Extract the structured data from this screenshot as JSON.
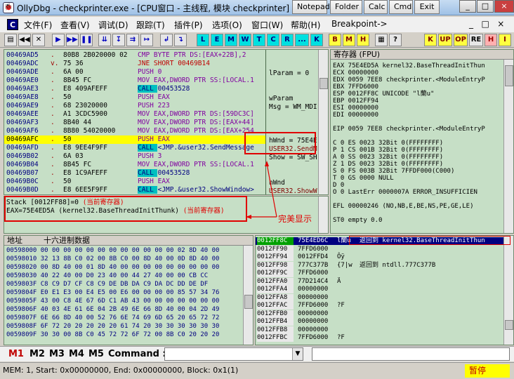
{
  "window": {
    "title": "OllyDbg - checkprinter.exe - [CPU窗口 - 主线程, 模块 checkprinter]",
    "taskbar_buttons": [
      "Notepad",
      "Folder",
      "Calc",
      "Cmd",
      "Exit"
    ],
    "controls": [
      "_",
      "□",
      "×"
    ]
  },
  "menu": {
    "logo": "C",
    "items": [
      "文件(F)",
      "查看(V)",
      "调试(D)",
      "跟踪(T)",
      "插件(P)",
      "选项(O)",
      "窗口(W)",
      "帮助(H)",
      "Breakpoint->"
    ],
    "right_controls": [
      "_",
      "□",
      "×"
    ]
  },
  "toolbar": {
    "control_glyphs": [
      "◀◀",
      "✕",
      "▶",
      "▶▶",
      "❚❚",
      "⇊",
      "↧",
      "⇉",
      "↦",
      "↲",
      "↴"
    ],
    "letters_cyan": [
      "L",
      "E",
      "M",
      "W",
      "T",
      "C",
      "R",
      "...",
      "K"
    ],
    "letters_yellow": [
      "B",
      "M",
      "H"
    ],
    "right_buttons": [
      "K",
      "UP",
      "OP",
      "RE",
      "H",
      "I"
    ]
  },
  "disasm": {
    "rows": [
      {
        "addr": "00469AD5",
        "mark": ".",
        "hex": "80B8 2B020000 02",
        "asm": "CMP BYTE PTR DS:[EAX+22B],2"
      },
      {
        "addr": "00469ADC",
        "mark": "v.",
        "hex": "75 36",
        "asm": "JNE SHORT 00469B14"
      },
      {
        "addr": "00469ADE",
        "mark": ".",
        "hex": "6A 00",
        "asm": "PUSH 0"
      },
      {
        "addr": "00469AE0",
        "mark": ".",
        "hex": "8B45 FC",
        "asm": "MOV EAX,DWORD PTR SS:[LOCAL.1"
      },
      {
        "addr": "00469AE3",
        "mark": ".",
        "hex": "E8 409AFEFF",
        "asm": "CALL 00453528"
      },
      {
        "addr": "00469AE8",
        "mark": ".",
        "hex": "50",
        "asm": "PUSH EAX"
      },
      {
        "addr": "00469AE9",
        "mark": ".",
        "hex": "68 23020000",
        "asm": "PUSH 223"
      },
      {
        "addr": "00469AEE",
        "mark": ".",
        "hex": "A1 3CDC5900",
        "asm": "MOV EAX,DWORD PTR DS:[59DC3C]"
      },
      {
        "addr": "00469AF3",
        "mark": ".",
        "hex": "8B40 44",
        "asm": "MOV EAX,DWORD PTR DS:[EAX+44]"
      },
      {
        "addr": "00469AF6",
        "mark": ".",
        "hex": "8B80 54020000",
        "asm": "MOV EAX,DWORD PTR DS:[EAX+254"
      },
      {
        "addr": "00469AFC",
        "mark": ".",
        "hex": "50",
        "asm": "PUSH EAX"
      },
      {
        "addr": "00469AFD",
        "mark": ".",
        "hex": "E8 9EE4F9FF",
        "asm": "CALL <JMP.&user32.SendMessage"
      },
      {
        "addr": "00469B02",
        "mark": ".",
        "hex": "6A 03",
        "asm": "PUSH 3"
      },
      {
        "addr": "00469B04",
        "mark": ".",
        "hex": "8B45 FC",
        "asm": "MOV EAX,DWORD PTR SS:[LOCAL.1"
      },
      {
        "addr": "00469B07",
        "mark": ".",
        "hex": "E8 1C9AFEFF",
        "asm": "CALL 00453528"
      },
      {
        "addr": "00469B0C",
        "mark": ".",
        "hex": "50",
        "asm": "PUSH EAX"
      },
      {
        "addr": "00469B0D",
        "mark": ".",
        "hex": "E8 6EE5F9FF",
        "asm": "CALL <JMP.&user32.ShowWindow>"
      }
    ],
    "selected_index": 10,
    "comments": [
      "lParam = 0",
      "wParam",
      "Msg = WM_MDI",
      "hWnd = 75E4E",
      "USER32.SendM",
      "Show = SW_SH",
      "hWnd",
      "USER32.ShowW"
    ]
  },
  "info_pane": {
    "line1": "Stack [0012FF88]=0",
    "line1_note": "(当前寄存器)",
    "line2": "EAX=75E4ED5A (kernel32.BaseThreadInitThunk)",
    "line2_note": "(当前寄存器)"
  },
  "annotation": {
    "text": "完美显示"
  },
  "registers": {
    "header": "寄存器 (FPU)",
    "rows": [
      "EAX 75E4ED5A kernel32.BaseThreadInitThun",
      "ECX 00000000",
      "EDX 0059 7EE8 checkprinter.<ModuleEntryP",
      "EBX 7FFD6000",
      "ESP 0012FF8C UNICODE \"l蘭u\"",
      "EBP 0012FF94",
      "ESI 00000000",
      "EDI 00000000",
      "",
      "EIP 0059 7EE8 checkprinter.<ModuleEntryP",
      "",
      "C 0  ES 0023 32Bit 0(FFFFFFFF)",
      "P 1  CS 001B 32Bit 0(FFFFFFFF)",
      "A 0  SS 0023 32Bit 0(FFFFFFFF)",
      "Z 1  DS 0023 32Bit 0(FFFFFFFF)",
      "S 0  FS 003B 32Bit 7FFDF000(C000)",
      "T 0  GS 0000 NULL",
      "D 0",
      "O 0  LastErr 0000007A ERROR_INSUFFICIEN",
      "",
      "EFL 00000246 (NO,NB,E,BE,NS,PE,GE,LE)",
      "",
      "ST0 empty 0.0"
    ]
  },
  "dump": {
    "col_addr": "地址",
    "col_hex": "十六进制数据",
    "rows": [
      "00598000 00 00 00 00 00 00 00 00 00 00 00 00 02 8D 40 00",
      "00598010 32 13 8B C0 02 00 8B C0 00 8D 40 00 0D 8D 40 00",
      "00598020 00 8D 40 00 01 8D 40 00 00 00 00 00 00 00 00 00",
      "00598030 40 22 40 00 D0 23 40 00 44 27 40 00 00 CB CC",
      "0059803F C8 C9 D7 CF C8 C9 DE DB DA C9 DA DC DD DE DF",
      "0059804F E0 E1 E3 00 E4 E5 00 E6 00 00 00 00 85 57 34 76",
      "0059805F 43 00 C8 4E 67 6D C1 AB 43 00 00 00 00 00 00 00",
      "0059806F 40 03 4E 61 6E 04 2B 49 6E 66 8D 40 00 04 2D 49",
      "0059807F 6E 66 8D 40 00 52 76 6E 74 69 6D 65 20 65 72 72",
      "0059808F 6F 72 20 20 20 20 20 61 74 20 30 30 30 30 30 30",
      "0059809F 30 30 00 8B C0 45 72 72 6F 72 00 8B C0 20 20 20"
    ]
  },
  "stack": {
    "rows": [
      {
        "addr": "0012FF8C",
        "val": "75E4ED6C",
        "ascii": "l蘭u",
        "comment": "返回到 kernel32.BaseThreadInitThun"
      },
      {
        "addr": "0012FF90",
        "val": "7FFD6000",
        "ascii": "",
        "comment": ""
      },
      {
        "addr": "0012FF94",
        "val": "0012FFD4",
        "ascii": "Ôÿ",
        "comment": ""
      },
      {
        "addr": "0012FF98",
        "val": "777C377B",
        "ascii": "{7|w",
        "comment": "返回到 ntdll.777C377B"
      },
      {
        "addr": "0012FF9C",
        "val": "7FFD6000",
        "ascii": "",
        "comment": ""
      },
      {
        "addr": "0012FFA0",
        "val": "77D214C4",
        "ascii": "Ä",
        "comment": ""
      },
      {
        "addr": "0012FFA4",
        "val": "00000000",
        "ascii": "",
        "comment": ""
      },
      {
        "addr": "0012FFA8",
        "val": "00000000",
        "ascii": "",
        "comment": ""
      },
      {
        "addr": "0012FFAC",
        "val": "7FFD6000",
        "ascii": "?F",
        "comment": ""
      },
      {
        "addr": "0012FFB0",
        "val": "00000000",
        "ascii": "",
        "comment": ""
      },
      {
        "addr": "0012FFB4",
        "val": "00000000",
        "ascii": "",
        "comment": ""
      },
      {
        "addr": "0012FFB8",
        "val": "00000000",
        "ascii": "",
        "comment": ""
      },
      {
        "addr": "0012FFBC",
        "val": "7FFD6000",
        "ascii": "?F",
        "comment": ""
      }
    ]
  },
  "command": {
    "tabs": [
      "M1",
      "M2",
      "M3",
      "M4",
      "M5"
    ],
    "label": "Command :",
    "value": ""
  },
  "status": {
    "text": "MEM: 1, Start: 0x00000000, End: 0x00000000, Block: 0x1(1)",
    "state": "暂停"
  }
}
